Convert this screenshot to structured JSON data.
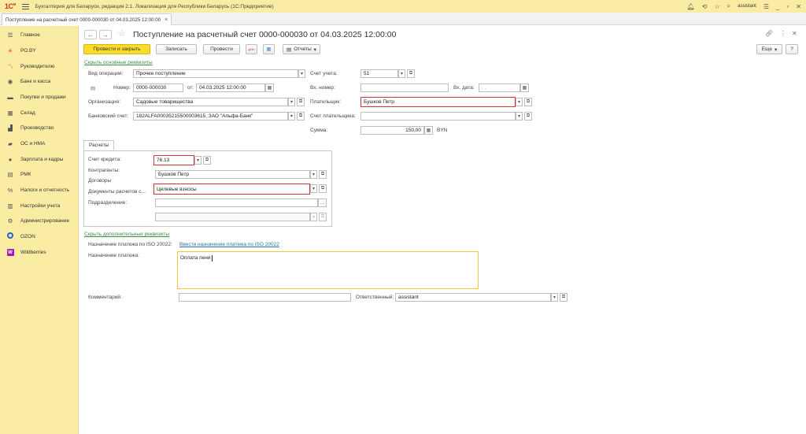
{
  "app": {
    "logo_text": "1С",
    "logo_sup": "м",
    "title": "Бухгалтерия для Беларуси, редакция 2.1. Локализация для Республики Беларусь   (1С:Предприятие)",
    "user": "assistant"
  },
  "titlebar_icons": [
    "bell-icon",
    "history-icon",
    "star-icon",
    "search-icon"
  ],
  "tab": {
    "label": "Поступление на расчетный счет 0000-000030 от 04.03.2025 12:00:00",
    "close": "×"
  },
  "sidebar": {
    "items": [
      {
        "label": "Главное",
        "icon": "☰"
      },
      {
        "label": "РО.BY",
        "icon": "✳"
      },
      {
        "label": "Руководителю",
        "icon": "〽"
      },
      {
        "label": "Банк и касса",
        "icon": "◉"
      },
      {
        "label": "Покупки и продажи",
        "icon": "▬"
      },
      {
        "label": "Склад",
        "icon": "▦"
      },
      {
        "label": "Производство",
        "icon": "▟"
      },
      {
        "label": "ОС и НМА",
        "icon": "▰"
      },
      {
        "label": "Зарплата и кадры",
        "icon": "●"
      },
      {
        "label": "РМК",
        "icon": "▤"
      },
      {
        "label": "Налоги и отчетность",
        "icon": "%"
      },
      {
        "label": "Настройки учета",
        "icon": "▥"
      },
      {
        "label": "Администрирование",
        "icon": "⚙"
      },
      {
        "label": "OZON",
        "icon": ""
      },
      {
        "label": "Wildberries",
        "icon": "W"
      }
    ]
  },
  "doc": {
    "title": "Поступление на расчетный счет 0000-000030 от 04.03.2025 12:00:00"
  },
  "toolbar": {
    "post_close": "Провести и закрыть",
    "save": "Записать",
    "post": "Провести",
    "dt_kt": "ДтКт",
    "reports": "Отчеты",
    "more": "Еще",
    "help": "?"
  },
  "links": {
    "hide_main": "Скрыть основные реквизиты",
    "hide_extra": "Скрыть дополнительные реквизиты",
    "enter_iso": "Ввести назначение платежа по ISO 20022"
  },
  "form": {
    "operation_label": "Вид операции:",
    "operation_value": "Прочее поступление",
    "number_label": "Номер:",
    "number_value": "0000-000030",
    "date_label": "от:",
    "date_value": "04.03.2025 12:00:00",
    "org_label": "Организация:",
    "org_value": "Садовые товарищества",
    "bank_label": "Банковский счет:",
    "bank_value": "182ALFA00035215500003615, ЗАО \"Альфа-Банк\"",
    "account_label": "Счет учета:",
    "account_value": "51",
    "in_number_label": "Вх. номер:",
    "in_number_value": "",
    "in_date_label": "Вх. дата:",
    "in_date_value": " .  .",
    "payer_label": "Плательщик:",
    "payer_value": "Бушков Петр",
    "payer_account_label": "Счет плательщика:",
    "payer_account_value": "",
    "sum_label": "Сумма:",
    "sum_value": "150,00",
    "currency": "BYN"
  },
  "settlements": {
    "tab_label": "Расчеты",
    "credit_label": "Счет кредита:",
    "credit_value": "76.13",
    "contractors_label": "Контрагенты:",
    "contractors_value": "Бушков Петр",
    "contracts_label": "Договоры",
    "docs_label": "Документы расчетов с...",
    "docs_value": "Целевые взносы",
    "division_label": "Подразделение:",
    "division_value": ""
  },
  "extra": {
    "iso_label": "Назначение платежа по ISO 20022:",
    "purpose_label": "Назначение платежа:",
    "purpose_value": "Оплата пени",
    "comment_label": "Комментарий:",
    "comment_value": "",
    "responsible_label": "Ответственный:",
    "responsible_value": "assistant"
  },
  "colors": {
    "sidebar_bg": "#fbeca4",
    "primary_button": "#fbdc2c",
    "error_border": "#d9303a",
    "focus_border": "#f0c838",
    "link": "#2f6fb5"
  }
}
